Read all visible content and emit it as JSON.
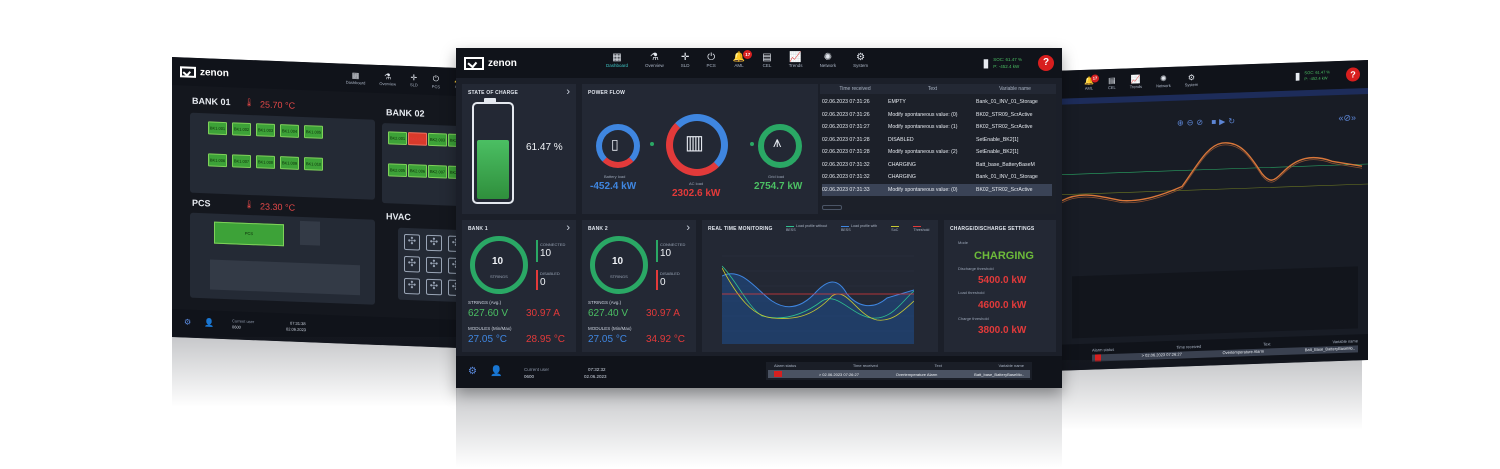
{
  "brand": {
    "logo_text": "zenon",
    "logo_sub": "by COPA-DATA"
  },
  "nav": [
    {
      "label": "Dashboard",
      "icon": "dashboard-icon"
    },
    {
      "label": "Overview",
      "icon": "overview-icon"
    },
    {
      "label": "SLD",
      "icon": "sld-icon"
    },
    {
      "label": "PCS",
      "icon": "power-icon"
    },
    {
      "label": "AML",
      "icon": "alarm-bell-icon",
      "badge": "17"
    },
    {
      "label": "CEL",
      "icon": "event-list-icon"
    },
    {
      "label": "Trends",
      "icon": "trends-icon"
    },
    {
      "label": "Network",
      "icon": "network-icon"
    },
    {
      "label": "System",
      "icon": "gear-icon"
    }
  ],
  "battery_status": {
    "soc": "SOC: 61.47 %",
    "power": "P: -452.4 kW"
  },
  "help_label": "?",
  "left": {
    "bank01": {
      "title": "BANK 01",
      "temp": "25.70 °C"
    },
    "bank02": {
      "title": "BANK 02"
    },
    "pcs": {
      "title": "PCS",
      "temp": "23.30 °C",
      "block": "PCS"
    },
    "hvac": {
      "title": "HVAC"
    },
    "bank01_cells": [
      "BK1.001",
      "BK1.002",
      "BK1.003",
      "BK1.004",
      "BK1.005",
      "BK1.006",
      "BK1.007",
      "BK1.008",
      "BK1.009",
      "BK1.010"
    ],
    "bank02_cells": [
      "BK2.001",
      "BK2.002",
      "BK2.003",
      "BK2.004",
      "BK2.005",
      "BK2.006",
      "BK2.007",
      "BK2.008"
    ],
    "footer": {
      "user_label": "Current user",
      "user": "0600",
      "time": "07:31:38",
      "date": "02.06.2023"
    }
  },
  "soc": {
    "title": "STATE OF CHARGE",
    "value": "61.47 %",
    "level": 0.6147
  },
  "power_flow": {
    "title": "POWER FLOW",
    "battery_label": "Battery load",
    "battery_value": "-452.4 kW",
    "ac_label": "AC load",
    "ac_value": "2302.6 kW",
    "grid_label": "Grid load",
    "grid_value": "2754.7 kW"
  },
  "alarm_table": {
    "headers": [
      "Time received",
      "Text",
      "Variable name"
    ],
    "rows": [
      [
        "02.06.2023 07:31:26",
        "EMPTY",
        "Bank_01_INV_01_Storage"
      ],
      [
        "02.06.2023 07:31:26",
        "Modify spontaneous value: (0)",
        "BK02_STR09_ScrActive"
      ],
      [
        "02.06.2023 07:31:27",
        "Modify spontaneous value: (1)",
        "BK02_STR02_ScrActive"
      ],
      [
        "02.06.2023 07:31:28",
        "DISABLED",
        "SetEnable_BK2[1]"
      ],
      [
        "02.06.2023 07:31:28",
        "Modify spontaneous value: (2)",
        "SetEnable_BK2[1]"
      ],
      [
        "02.06.2023 07:31:32",
        "CHARGING",
        "Batt_base_BatteryBaseM"
      ],
      [
        "02.06.2023 07:31:32",
        "CHARGING",
        "Bank_01_INV_01_Storage"
      ],
      [
        "02.06.2023 07:31:33",
        "Modify spontaneous value: (0)",
        "BK02_STR02_ScrActive"
      ]
    ]
  },
  "bank1": {
    "title": "BANK 1",
    "strings": "10",
    "strings_label": "STRINGS",
    "connected_label": "CONNECTED",
    "connected": "10",
    "disabled_label": "DISABLED",
    "disabled": "0",
    "strings_avg_label": "STRINGS (Avg.)",
    "voltage": "627.60",
    "voltage_unit": "V",
    "current": "30.97",
    "current_unit": "A",
    "modules_label": "MODULES (Min/Max)",
    "tmin": "27.05",
    "tmax": "28.95",
    "tunit": "°C"
  },
  "bank2": {
    "title": "BANK 2",
    "strings": "10",
    "strings_label": "STRINGS",
    "connected_label": "CONNECTED",
    "connected": "10",
    "disabled_label": "DISABLED",
    "disabled": "0",
    "strings_avg_label": "STRINGS (Avg.)",
    "voltage": "627.40",
    "voltage_unit": "V",
    "current": "30.97",
    "current_unit": "A",
    "modules_label": "MODULES (Min/Max)",
    "tmin": "27.05",
    "tmax": "34.92",
    "tunit": "°C"
  },
  "realtime": {
    "title": "REAL TIME MONITORING",
    "legend": [
      {
        "name": "Load profile without BESS",
        "color": "#2fbf8f"
      },
      {
        "name": "Load profile with BESS",
        "color": "#3f86e0"
      },
      {
        "name": "SoC",
        "color": "#c8c832"
      },
      {
        "name": "Threshold",
        "color": "#e23a3a"
      }
    ]
  },
  "charge_settings": {
    "title": "CHARGE/DISCHARGE SETTINGS",
    "mode_label": "Mode",
    "mode": "CHARGING",
    "discharge_label": "Discharge threshold",
    "discharge": "5400.0 kW",
    "load_label": "Load threshold",
    "load": "4600.0 kW",
    "charge_label": "Charge threshold",
    "charge": "3800.0 kW"
  },
  "center_footer": {
    "user_label": "Current user",
    "user": "0600",
    "time": "07:32:32",
    "date": "02.06.2023",
    "alarm_headers": [
      "Alarm status",
      "Time received",
      "Text",
      "Variable name"
    ],
    "alarm_row": [
      "",
      "> 02.06.2023 07:26:27",
      "Overtemperature Alarm",
      "Batt_base_BatteryBaseMo.."
    ]
  },
  "right": {
    "footer_alarm": [
      "Alarm status",
      "Time received",
      "Text",
      "Variable name"
    ],
    "footer_row": [
      "",
      "> 02.06.2023 07:26:27",
      "Overtemperature Alarm",
      "Batt_Base_BatteryBaseMo.."
    ]
  },
  "colors": {
    "accent_green": "#4bbf63",
    "alarm_red": "#e23a3a",
    "blue": "#3f86e0",
    "bg": "#1b1f29"
  }
}
